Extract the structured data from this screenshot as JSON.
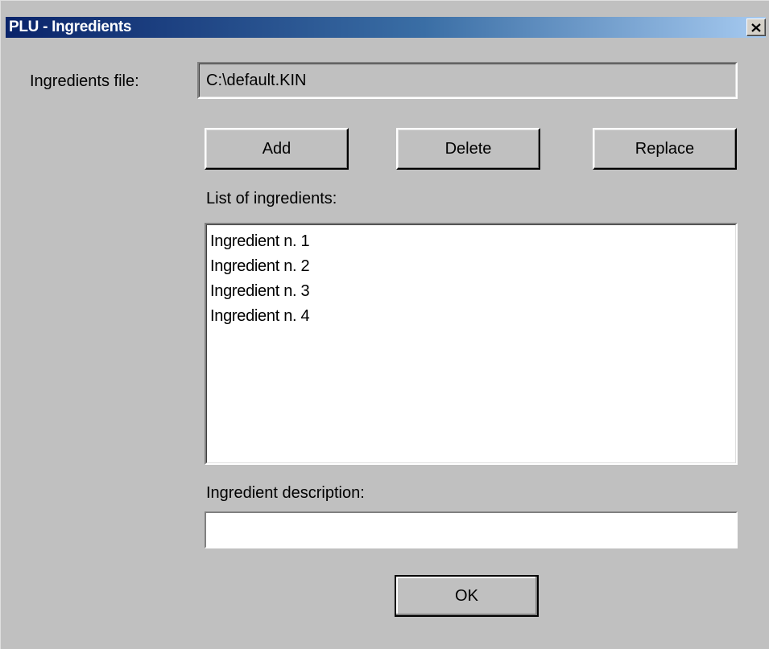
{
  "window": {
    "title": "PLU - Ingredients"
  },
  "ingredients_file": {
    "label": "Ingredients file:",
    "value": "C:\\default.KIN"
  },
  "buttons": {
    "add": "Add",
    "delete": "Delete",
    "replace": "Replace",
    "ok": "OK"
  },
  "list": {
    "label": "List of ingredients:",
    "items": [
      "Ingredient n. 1",
      "Ingredient n. 2",
      "Ingredient n. 3",
      "Ingredient n. 4"
    ]
  },
  "description": {
    "label": "Ingredient description:",
    "value": ""
  },
  "icons": {
    "close": "close-icon"
  },
  "colors": {
    "face": "#c0c0c0",
    "titlebar_start": "#0a246a",
    "titlebar_end": "#a6caf0",
    "title_text": "#ffffff"
  }
}
